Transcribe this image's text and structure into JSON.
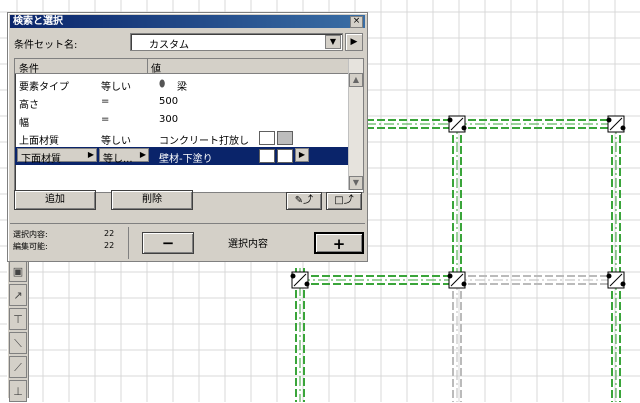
{
  "dialog": {
    "title": "検索と選択",
    "close_glyph": "×",
    "criteria_set_label": "条件セット名:",
    "criteria_set_value": "カスタム",
    "combo_arrow": "▼",
    "nav_arrow": "▶",
    "table": {
      "headers": [
        "条件",
        "値"
      ],
      "rows": [
        {
          "criterion": "要素タイプ",
          "operator": "等しい",
          "icon": "beam-icon",
          "value": "梁"
        },
        {
          "criterion": "高さ",
          "operator": "=",
          "value": "500"
        },
        {
          "criterion": "幅",
          "operator": "=",
          "value": "300"
        },
        {
          "criterion": "上面材質",
          "operator": "等しい",
          "value": "コンクリート打放し"
        },
        {
          "criterion": "下面材質",
          "operator": "等し...",
          "value": "壁材-下塗り",
          "selected": true
        }
      ],
      "row_arrow": "▶",
      "scroll_up": "▲",
      "scroll_down": "▼"
    },
    "buttons": {
      "add": "追加",
      "delete": "削除",
      "minus": "−",
      "plus": "+"
    },
    "status": {
      "selected_label": "選択内容:",
      "selected_count": "22",
      "editable_label": "編集可能:",
      "editable_count": "22",
      "selection_label": "選択内容"
    }
  },
  "colors": {
    "title_bar": "#0a246a",
    "selection": "#0a246a",
    "beam_green": "#3aa53a",
    "grid": "#d8d8d8"
  }
}
